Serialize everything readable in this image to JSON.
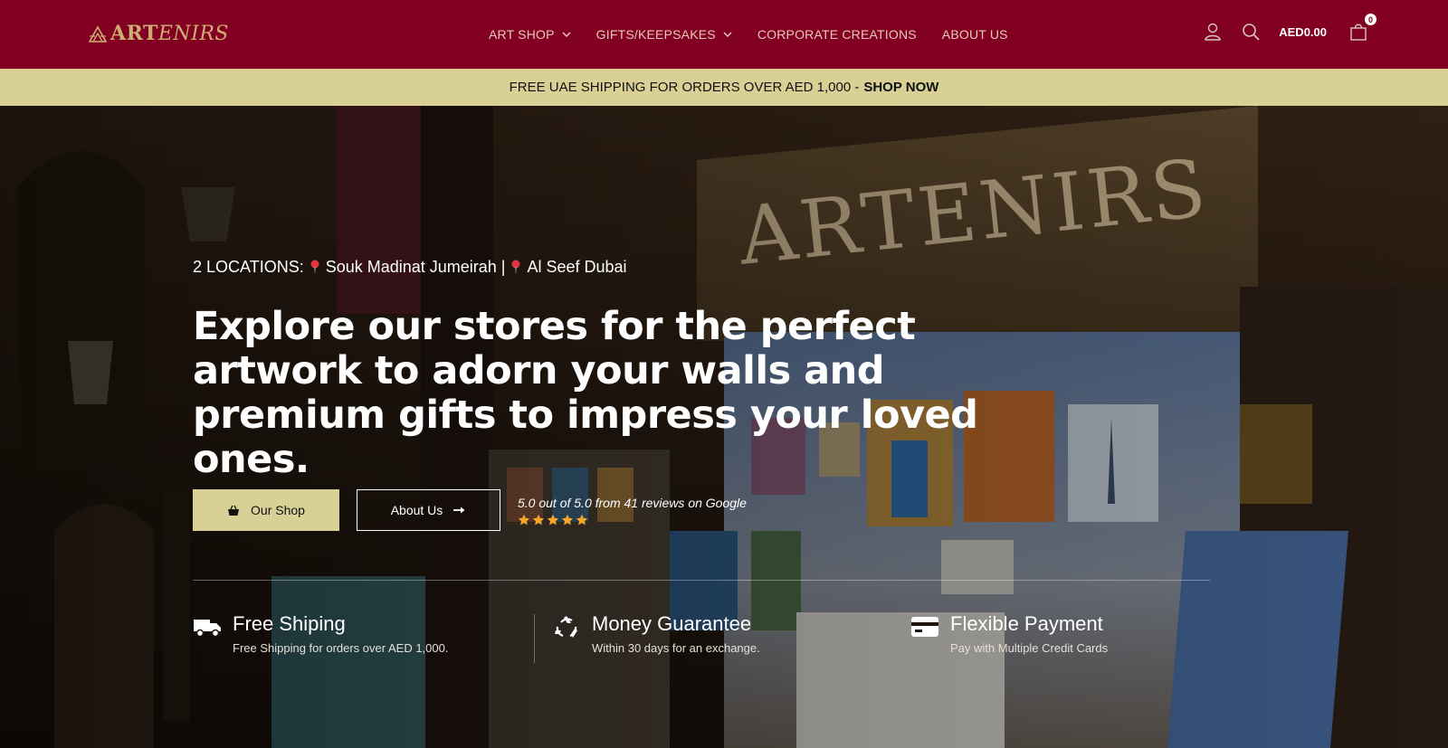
{
  "brand": {
    "logo_part1": "ART",
    "logo_part2": "ENIRS",
    "colors": {
      "header_bg": "#820021",
      "promo_bg": "#d9d095",
      "gold": "#cdae73",
      "star": "#f4a62a"
    }
  },
  "nav": {
    "items": [
      {
        "label": "ART SHOP",
        "has_dropdown": true
      },
      {
        "label": "GIFTS/KEEPSAKES",
        "has_dropdown": true
      },
      {
        "label": "CORPORATE CREATIONS",
        "has_dropdown": false
      },
      {
        "label": "ABOUT US",
        "has_dropdown": false
      }
    ]
  },
  "header_actions": {
    "account_icon": "user-icon",
    "search_icon": "search-icon",
    "cart_total": "AED0.00",
    "cart_count": "0",
    "cart_icon": "shopping-bag-icon"
  },
  "promo": {
    "text": "FREE UAE SHIPPING FOR ORDERS OVER AED 1,000 -",
    "link": "SHOP NOW"
  },
  "hero": {
    "background_sign": "ARTENIRS",
    "locations_label": "2 LOCATIONS:",
    "location1": "Souk Madinat Jumeirah |",
    "location2": "Al Seef Dubai",
    "headline": "Explore our stores for the perfect artwork to adorn your walls and premium gifts to impress your loved ones.",
    "shop_button": "Our Shop",
    "about_button": "About Us",
    "rating_text": "5.0 out of 5.0 from 41 reviews on Google",
    "rating_stars": 5
  },
  "features": [
    {
      "icon": "truck-icon",
      "title": "Free Shiping",
      "desc": "Free Shipping for orders over AED 1,000."
    },
    {
      "icon": "recycle-icon",
      "title": "Money Guarantee",
      "desc": "Within 30 days for an exchange."
    },
    {
      "icon": "credit-card-icon",
      "title": "Flexible Payment",
      "desc": "Pay with Multiple Credit Cards"
    }
  ]
}
